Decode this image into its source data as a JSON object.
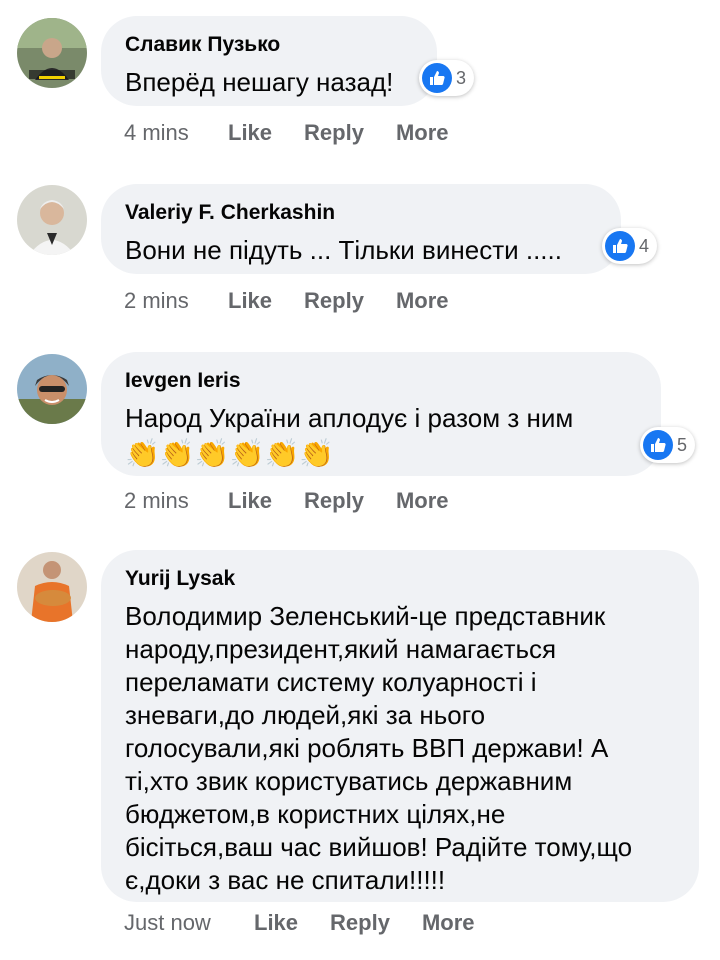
{
  "comments": [
    {
      "author": "Славик Пузько",
      "text": "Вперёд нешагу назад!",
      "likes": "3",
      "time": "4 mins",
      "actions": {
        "like": "Like",
        "reply": "Reply",
        "more": "More"
      }
    },
    {
      "author": "Valeriy F. Cherkashin",
      "text": "Вони не підуть ... Тільки винести .....",
      "likes": "4",
      "time": "2 mins",
      "actions": {
        "like": "Like",
        "reply": "Reply",
        "more": "More"
      }
    },
    {
      "author": "Ievgen Ieris",
      "text": "Народ України аплодує і разом з ним",
      "emoji": "👏👏👏👏👏👏",
      "likes": "5",
      "time": "2 mins",
      "actions": {
        "like": "Like",
        "reply": "Reply",
        "more": "More"
      }
    },
    {
      "author": "Yurij Lysak",
      "text": "Володимир Зеленський-це представник\nнароду,президент,який намагається\nпереламати систему колуарності і\nзневаги,до людей,які за нього\nголосували,які роблять ВВП держави! А\nті,хто звик користуватись державним\nбюджетом,в користних цілях,не\nбісіться,ваш час вийшов! Радійте тому,що\nє,доки з вас не спитали!!!!!",
      "time": "Just now",
      "actions": {
        "like": "Like",
        "reply": "Reply",
        "more": "More"
      }
    }
  ],
  "colors": {
    "bubble": "#f0f2f5",
    "meta": "#65676b",
    "like_blue": "#1877f2"
  },
  "icons": {
    "like": "thumbs-up-icon",
    "emoji": "clapping-hands"
  }
}
